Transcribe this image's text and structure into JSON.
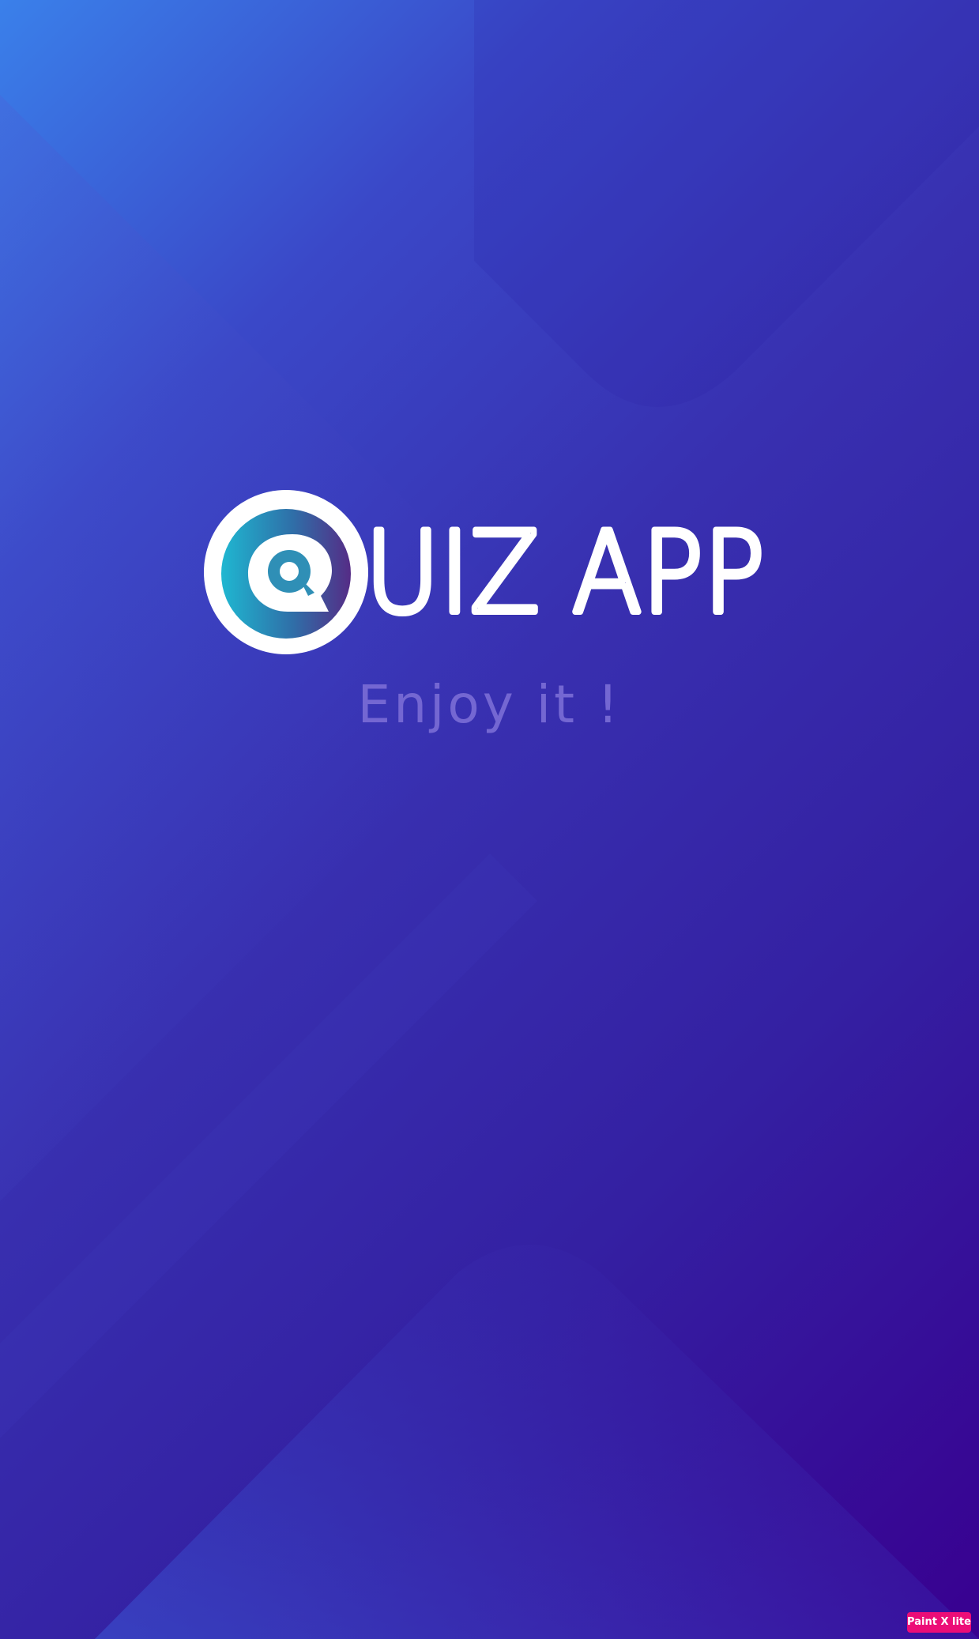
{
  "app": {
    "title": "UIZ APP",
    "tagline": "Enjoy it !"
  },
  "logo": {
    "icon": "quiz-q-speech-bubble-icon"
  },
  "watermark": {
    "label": "Paint X lite"
  },
  "colors": {
    "background_start": "#3a80ea",
    "background_end": "#380090",
    "logo_ring": "#ffffff",
    "logo_gradient_start": "#1fb7d1",
    "logo_gradient_end": "#552c86",
    "tagline": "#7467d2",
    "watermark": "#ec0d77"
  }
}
